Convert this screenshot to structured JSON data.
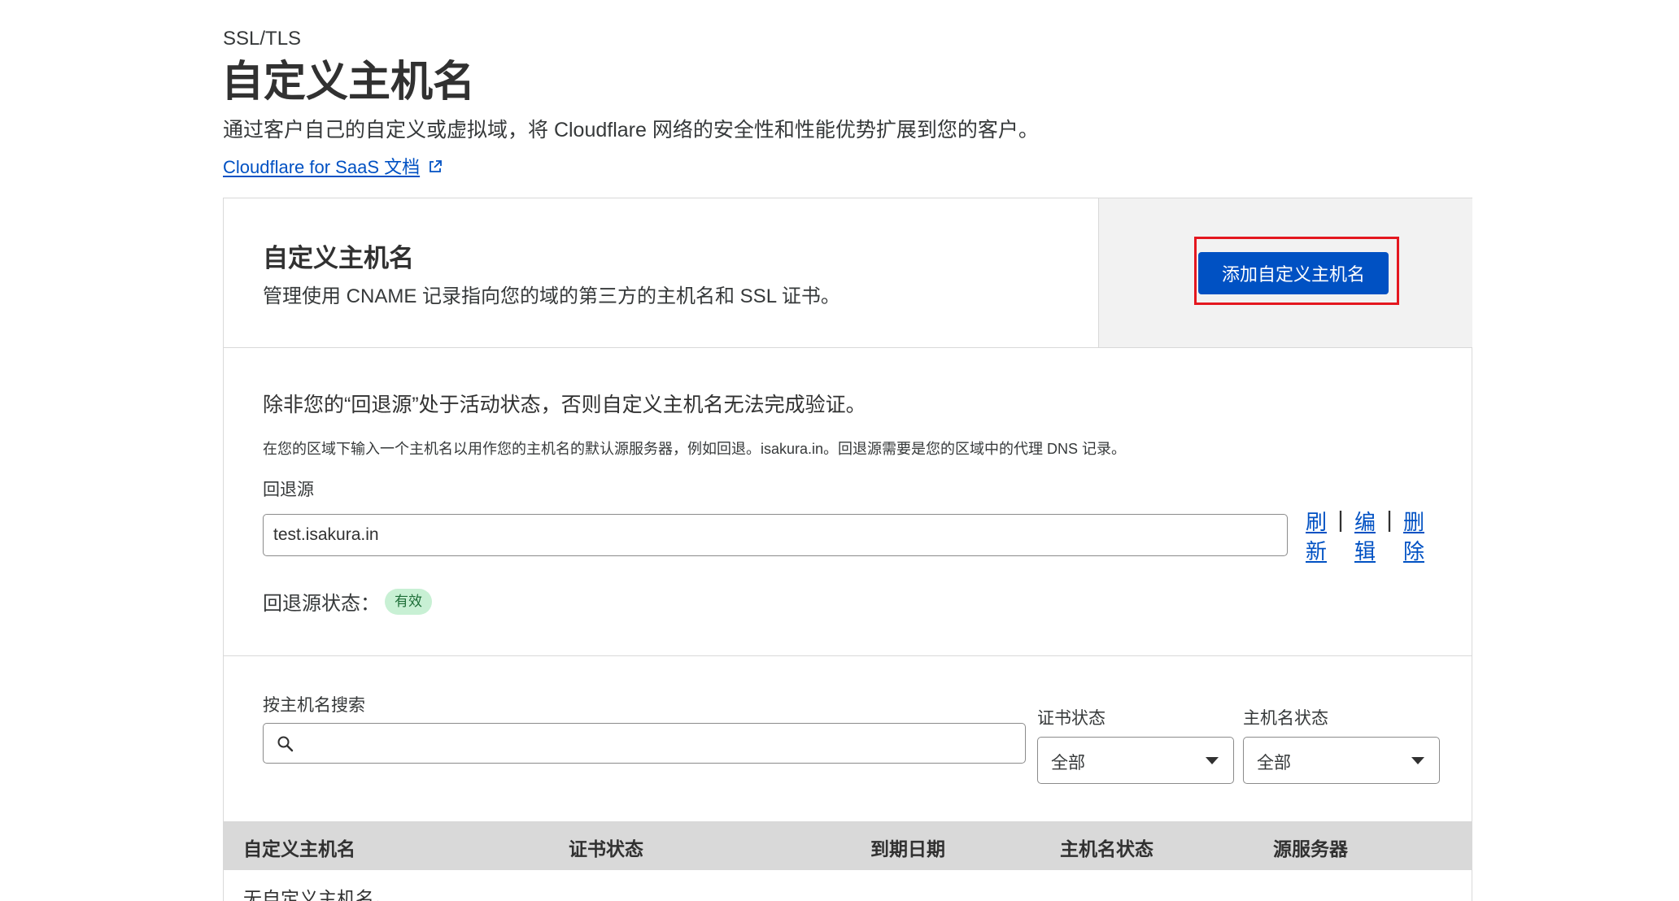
{
  "header": {
    "breadcrumb": "SSL/TLS",
    "title": "自定义主机名",
    "description": "通过客户自己的自定义或虚拟域，将 Cloudflare 网络的安全性和性能优势扩展到您的客户。",
    "doc_link": "Cloudflare for SaaS 文档"
  },
  "card": {
    "title": "自定义主机名",
    "description": "管理使用 CNAME 记录指向您的域的第三方的主机名和 SSL 证书。",
    "add_button": "添加自定义主机名"
  },
  "fallback": {
    "heading": "除非您的“回退源”处于活动状态，否则自定义主机名无法完成验证。",
    "help": "在您的区域下输入一个主机名以用作您的主机名的默认源服务器，例如回退。isakura.in。回退源需要是您的区域中的代理 DNS 记录。",
    "label": "回退源",
    "value": "test.isakura.in",
    "actions": {
      "refresh": "刷新",
      "edit": "编辑",
      "delete": "删除",
      "separator": "|"
    },
    "status_label": "回退源状态：",
    "status_badge": "有效"
  },
  "filters": {
    "search_label": "按主机名搜索",
    "search_value": "",
    "cert_status_label": "证书状态",
    "cert_status_value": "全部",
    "host_status_label": "主机名状态",
    "host_status_value": "全部"
  },
  "table": {
    "columns": [
      "自定义主机名",
      "证书状态",
      "到期日期",
      "主机名状态",
      "源服务器"
    ],
    "empty_text": "无自定义主机名。"
  },
  "colors": {
    "accent": "#0051c3",
    "highlight": "#e4171f",
    "badge_bg": "#c8f0d4",
    "header_bg": "#d9d9d9"
  }
}
